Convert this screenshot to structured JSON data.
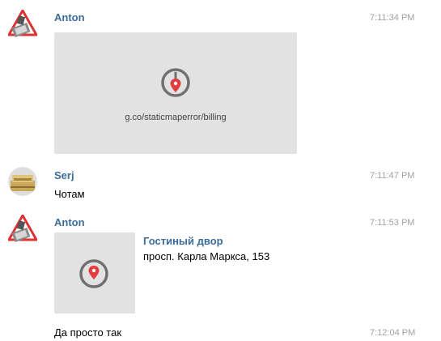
{
  "messages": [
    {
      "author": "Anton",
      "time": "7:11:34 PM",
      "avatar_icon": "road-sign-avatar",
      "map_error_text": "g.co/staticmaperror/billing",
      "map_icon": "map-pin-icon"
    },
    {
      "author": "Serj",
      "time": "7:11:47 PM",
      "avatar_icon": "gold-bars-avatar",
      "text": "Чотам"
    },
    {
      "author": "Anton",
      "time": "7:11:53 PM",
      "avatar_icon": "road-sign-avatar",
      "venue": {
        "title": "Гостиный двор",
        "address": "просп. Карла Маркса, 153"
      },
      "map_icon": "map-pin-icon"
    },
    {
      "time": "7:12:04 PM",
      "text": "Да просто так"
    }
  ],
  "colors": {
    "author_name": "#3a6d99",
    "timestamp": "#a0a0a0",
    "map_placeholder": "#e2e2e2",
    "pin_red": "#e23d3d",
    "pin_ring": "#707070"
  }
}
